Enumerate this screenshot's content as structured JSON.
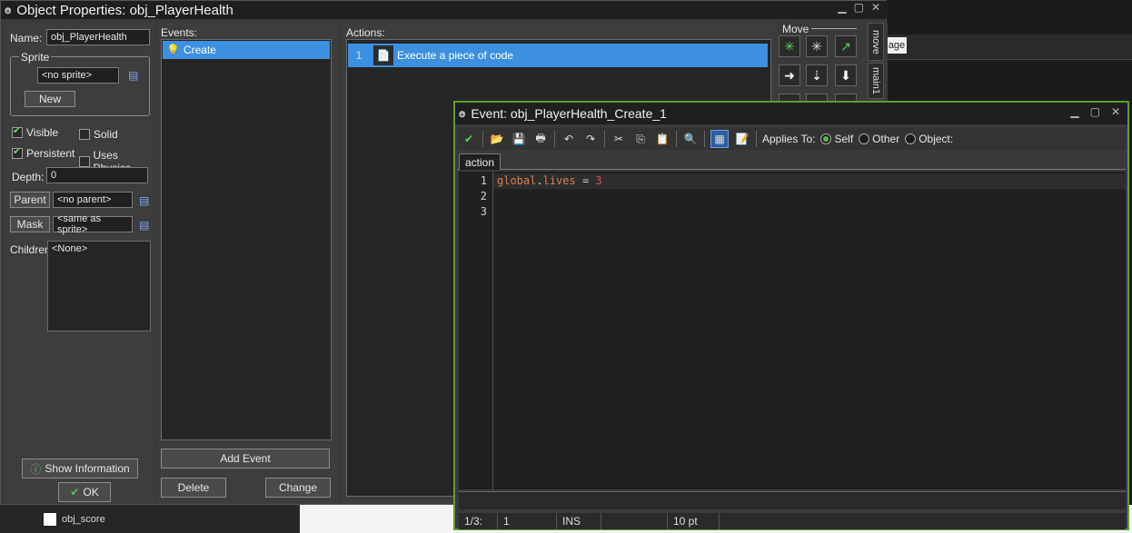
{
  "object_window": {
    "title": "Object Properties: obj_PlayerHealth",
    "name_label": "Name:",
    "name_value": "obj_PlayerHealth",
    "sprite_group_label": "Sprite",
    "sprite_value": "<no sprite>",
    "new_button": "New",
    "visible_label": "Visible",
    "visible_checked": true,
    "solid_label": "Solid",
    "solid_checked": false,
    "persistent_label": "Persistent",
    "persistent_checked": true,
    "uses_physics_label": "Uses Physics",
    "uses_physics_checked": false,
    "depth_label": "Depth:",
    "depth_value": "0",
    "parent_button": "Parent",
    "parent_value": "<no parent>",
    "mask_button": "Mask",
    "mask_value": "<same as sprite>",
    "children_label": "Children:",
    "children_value": "<None>",
    "show_info_button": "Show Information",
    "ok_button": "OK",
    "events_label": "Events:",
    "events": [
      {
        "label": "Create",
        "icon": "lightbulb-icon"
      }
    ],
    "add_event_button": "Add Event",
    "delete_button": "Delete",
    "change_button": "Change",
    "actions_label": "Actions:",
    "actions": [
      {
        "number": "1",
        "label": "Execute a piece of code",
        "icon": "code-page-icon"
      }
    ],
    "move_group_label": "Move",
    "side_tabs": [
      "move",
      "main1"
    ]
  },
  "event_window": {
    "title": "Event: obj_PlayerHealth_Create_1",
    "applies_to_label": "Applies To:",
    "applies_options": [
      {
        "label": "Self",
        "selected": true
      },
      {
        "label": "Other",
        "selected": false
      },
      {
        "label": "Object:",
        "selected": false
      }
    ],
    "tab_label": "action",
    "line_numbers": [
      "1",
      "2",
      "3"
    ],
    "code_lines": [
      {
        "tokens": [
          {
            "text": "global",
            "color": "#d98050"
          },
          {
            "text": ".",
            "color": "#d0d0d0"
          },
          {
            "text": "lives",
            "color": "#d98050"
          },
          {
            "text": " = ",
            "color": "#d0d0d0"
          },
          {
            "text": "3",
            "color": "#e05050"
          }
        ]
      },
      {
        "tokens": []
      },
      {
        "tokens": []
      }
    ],
    "status": {
      "position": "1/3:",
      "column": "1",
      "mode": "INS",
      "blank": "",
      "font_size": "10 pt"
    }
  },
  "background": {
    "behind_button": "age",
    "tree_item": "obj_score"
  },
  "colors": {
    "accent_green": "#5aa02a",
    "selection_blue": "#3d8fe0"
  }
}
